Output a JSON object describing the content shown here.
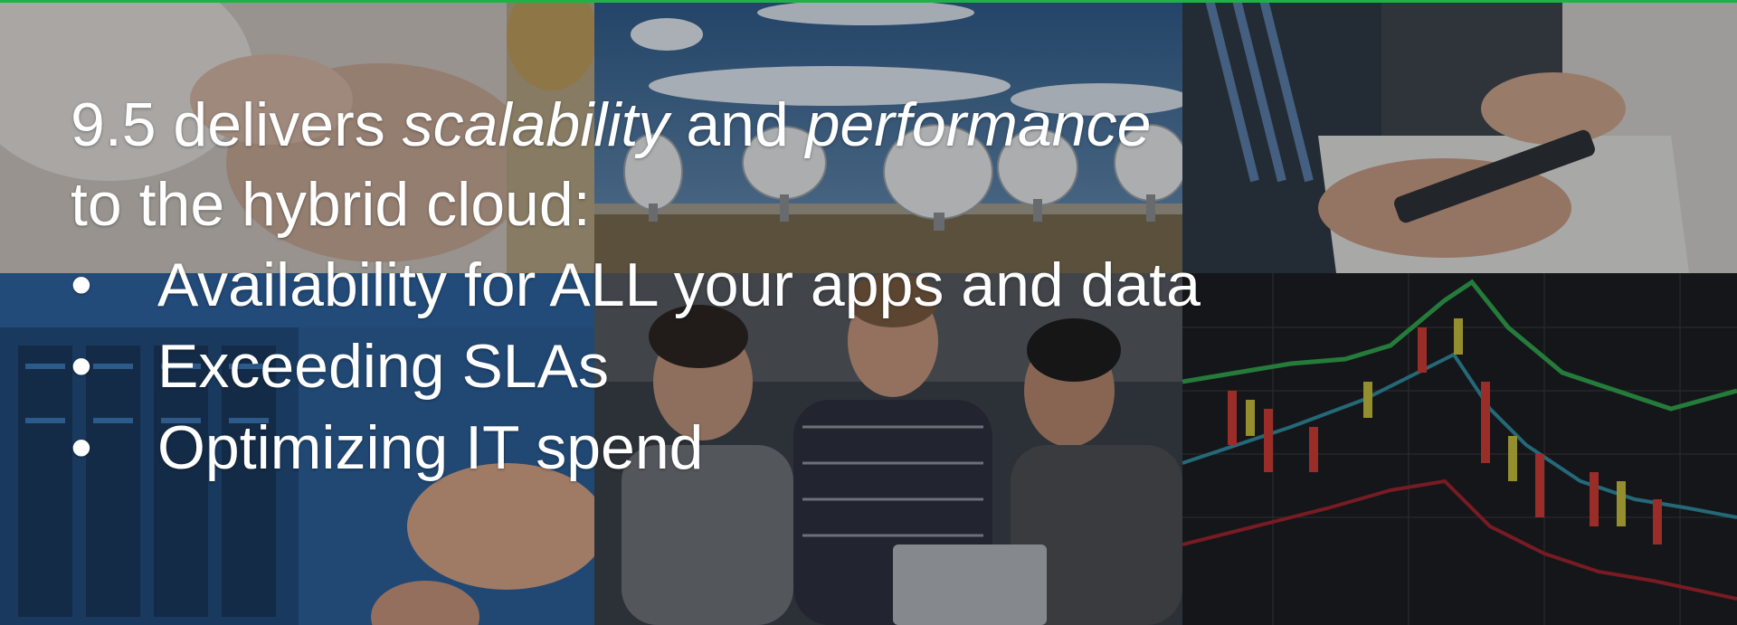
{
  "slide": {
    "headline": {
      "part1": "9.5 delivers ",
      "scalability": "scalability",
      "part2": " and ",
      "performance": "performance",
      "line2": "to the hybrid cloud:"
    },
    "bullet_glyph": "•",
    "bullets": [
      "Availability for ALL your apps and data",
      "Exceeding SLAs",
      "Optimizing IT spend"
    ]
  },
  "colors": {
    "accent_rule": "#1fb146",
    "text": "#ffffff"
  }
}
